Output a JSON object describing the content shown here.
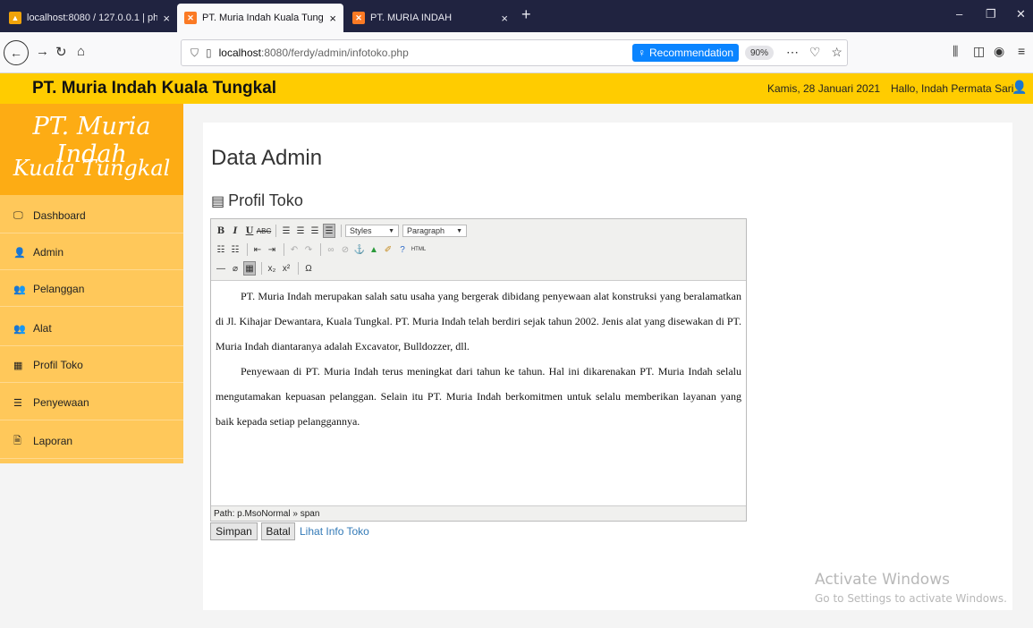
{
  "browser": {
    "tabs": [
      {
        "title": "localhost:8080 / 127.0.0.1 | php",
        "close": "×",
        "active": false
      },
      {
        "title": "PT. Muria Indah Kuala Tungkal",
        "close": "×",
        "active": true
      },
      {
        "title": "PT. MURIA INDAH",
        "close": "×",
        "active": false
      }
    ],
    "new_tab": "+",
    "url_host": "localhost",
    "url_rest": ":8080/ferdy/admin/infotoko.php",
    "recommendation_label": "Recommendation",
    "zoom": "90%",
    "window_controls": [
      "–",
      "❐",
      "✕"
    ]
  },
  "header": {
    "brand": "PT. Muria Indah Kuala Tungkal",
    "date": "Kamis, 28 Januari 2021",
    "greeting": "Hallo, Indah Permata Sari"
  },
  "sidebar": {
    "brand_line1": "PT. Muria Indah",
    "brand_line2": "Kuala Tungkal",
    "items": [
      {
        "label": "Dashboard",
        "icon": "monitor-icon"
      },
      {
        "label": "Admin",
        "icon": "user-icon"
      },
      {
        "label": "Pelanggan",
        "icon": "users-icon"
      },
      {
        "label": "Alat",
        "icon": "users-icon"
      },
      {
        "label": "Profil Toko",
        "icon": "table-icon"
      },
      {
        "label": "Penyewaan",
        "icon": "list-icon"
      },
      {
        "label": "Laporan",
        "icon": "file-icon"
      }
    ]
  },
  "main": {
    "title": "Data Admin",
    "subtitle": "Profil Toko",
    "editor": {
      "styles_select": "Styles",
      "format_select": "Paragraph",
      "paragraphs": [
        "PT. Muria Indah merupakan salah satu usaha yang bergerak dibidang penyewaan alat konstruksi yang beralamatkan di Jl. Kihajar Dewantara, Kuala Tungkal. PT. Muria Indah telah berdiri sejak tahun 2002. Jenis alat yang disewakan di PT. Muria Indah diantaranya adalah Excavator, Bulldozzer, dll.",
        "Penyewaan di PT. Muria Indah terus meningkat dari tahun ke tahun. Hal ini dikarenakan PT. Muria Indah selalu mengutamakan kepuasan pelanggan. Selain itu PT. Muria Indah berkomitmen untuk selalu memberikan layanan yang baik kepada setiap pelanggannya."
      ],
      "path": "Path: p.MsoNormal » span"
    },
    "save_label": "Simpan",
    "cancel_label": "Batal",
    "view_link": "Lihat Info Toko"
  },
  "watermark": {
    "line1": "Activate Windows",
    "line2": "Go to Settings to activate Windows."
  }
}
